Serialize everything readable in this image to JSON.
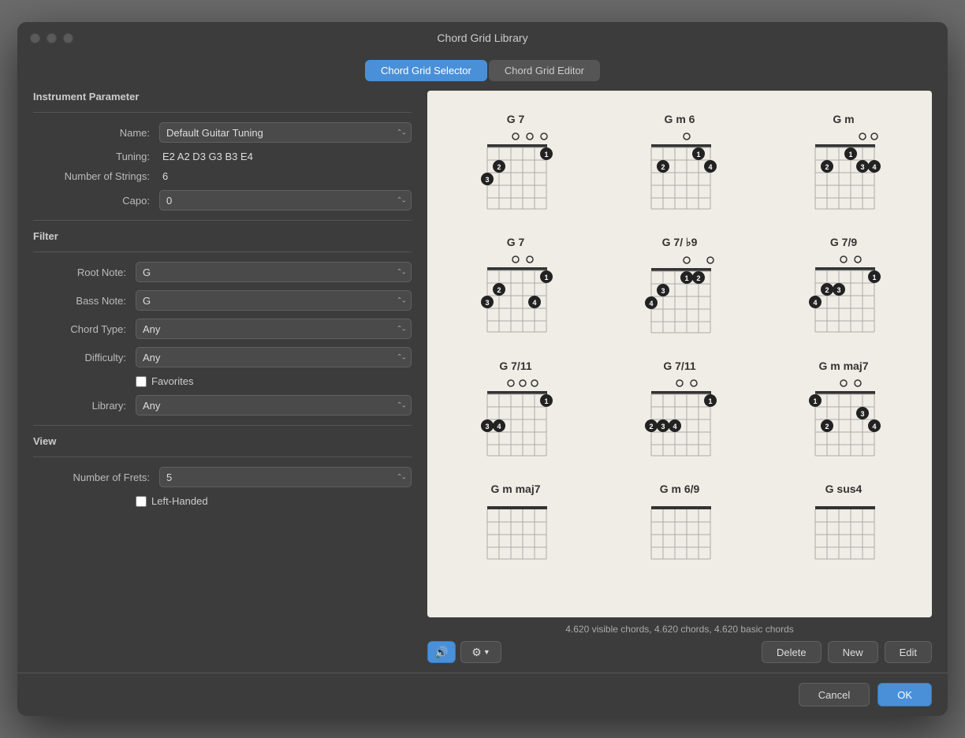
{
  "window": {
    "title": "Chord Grid Library"
  },
  "tabs": [
    {
      "id": "selector",
      "label": "Chord Grid Selector",
      "active": true
    },
    {
      "id": "editor",
      "label": "Chord Grid Editor",
      "active": false
    }
  ],
  "instrument": {
    "section_title": "Instrument Parameter",
    "name_label": "Name:",
    "name_value": "Default Guitar Tuning",
    "tuning_label": "Tuning:",
    "tuning_value": "E2 A2 D3 G3 B3 E4",
    "strings_label": "Number of Strings:",
    "strings_value": "6",
    "capo_label": "Capo:",
    "capo_value": "0"
  },
  "filter": {
    "section_title": "Filter",
    "root_note_label": "Root Note:",
    "root_note_value": "G",
    "bass_note_label": "Bass Note:",
    "bass_note_value": "G",
    "chord_type_label": "Chord Type:",
    "chord_type_value": "Any",
    "difficulty_label": "Difficulty:",
    "difficulty_value": "Any",
    "favorites_label": "Favorites",
    "library_label": "Library:",
    "library_value": "Any"
  },
  "view": {
    "section_title": "View",
    "frets_label": "Number of Frets:",
    "frets_value": "5",
    "lefthanded_label": "Left-Handed"
  },
  "status": {
    "text": "4.620 visible chords, 4.620 chords, 4.620 basic chords"
  },
  "buttons": {
    "delete": "Delete",
    "new": "New",
    "edit": "Edit",
    "cancel": "Cancel",
    "ok": "OK"
  },
  "chords": [
    {
      "name": "G 7",
      "row": 0,
      "col": 0
    },
    {
      "name": "G m 6",
      "row": 0,
      "col": 1
    },
    {
      "name": "G m",
      "row": 0,
      "col": 2
    },
    {
      "name": "G 7",
      "row": 1,
      "col": 0
    },
    {
      "name": "G 7/ ♭9",
      "row": 1,
      "col": 1
    },
    {
      "name": "G 7/9",
      "row": 1,
      "col": 2
    },
    {
      "name": "G 7/11",
      "row": 2,
      "col": 0
    },
    {
      "name": "G 7/11",
      "row": 2,
      "col": 1
    },
    {
      "name": "G m maj7",
      "row": 2,
      "col": 2
    },
    {
      "name": "G m maj7",
      "row": 3,
      "col": 0
    },
    {
      "name": "G m 6/9",
      "row": 3,
      "col": 1
    },
    {
      "name": "G sus4",
      "row": 3,
      "col": 2
    }
  ]
}
